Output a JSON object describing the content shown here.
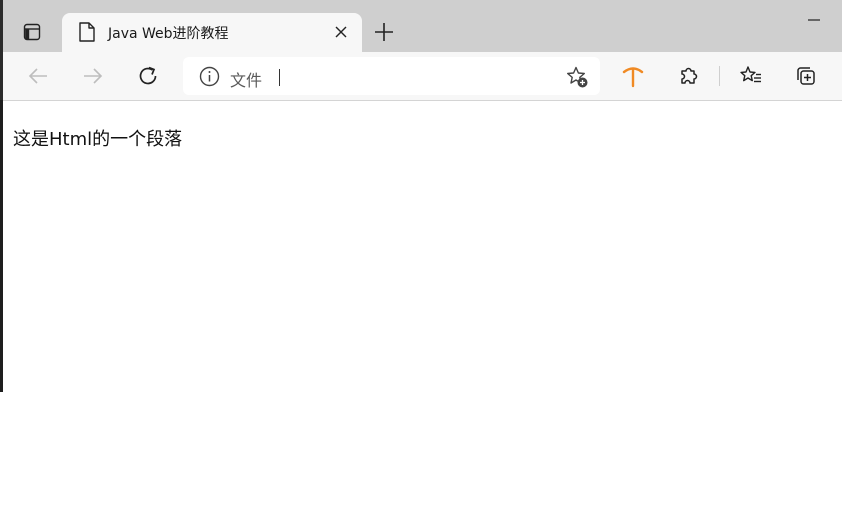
{
  "tab": {
    "title": "Java Web进阶教程"
  },
  "address_bar": {
    "scheme_label": "文件",
    "url_value": ""
  },
  "page": {
    "paragraph": "这是Html的一个段落"
  },
  "colors": {
    "tabstrip_bg": "#cfcfcf",
    "toolbar_bg": "#f7f7f7",
    "accent_orange": "#f08a24"
  }
}
